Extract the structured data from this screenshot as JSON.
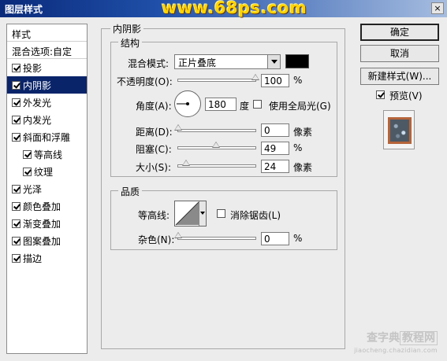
{
  "window": {
    "title": "图层样式",
    "brand": "www.68ps.com",
    "close_glyph": "×"
  },
  "styles_panel": {
    "header": "样式",
    "blend_options": "混合选项:自定",
    "items": [
      {
        "label": "投影",
        "checked": true
      },
      {
        "label": "内阴影",
        "checked": true,
        "selected": true
      },
      {
        "label": "外发光",
        "checked": true
      },
      {
        "label": "内发光",
        "checked": true
      },
      {
        "label": "斜面和浮雕",
        "checked": true
      },
      {
        "label": "等高线",
        "checked": true,
        "sub": true
      },
      {
        "label": "纹理",
        "checked": true,
        "sub": true
      },
      {
        "label": "光泽",
        "checked": true
      },
      {
        "label": "颜色叠加",
        "checked": true
      },
      {
        "label": "渐变叠加",
        "checked": true
      },
      {
        "label": "图案叠加",
        "checked": true
      },
      {
        "label": "描边",
        "checked": true
      }
    ]
  },
  "inner_shadow": {
    "group_title": "内阴影",
    "structure": {
      "title": "结构",
      "blend_mode_label": "混合模式:",
      "blend_mode_value": "正片叠底",
      "color": "#000000",
      "opacity_label": "不透明度(O):",
      "opacity_value": "100",
      "opacity_unit": "%",
      "opacity_percent": 100,
      "angle_label": "角度(A):",
      "angle_value": "180",
      "angle_unit": "度",
      "angle_degrees": 180,
      "global_light_label": "使用全局光(G)",
      "global_light_checked": false,
      "distance_label": "距离(D):",
      "distance_value": "0",
      "distance_unit": "像素",
      "distance_fraction": 0.0,
      "choke_label": "阻塞(C):",
      "choke_value": "49",
      "choke_unit": "%",
      "choke_fraction": 0.49,
      "size_label": "大小(S):",
      "size_value": "24",
      "size_unit": "像素",
      "size_fraction": 0.1
    },
    "quality": {
      "title": "品质",
      "contour_label": "等高线:",
      "antialias_label": "消除锯齿(L)",
      "antialias_checked": false,
      "noise_label": "杂色(N):",
      "noise_value": "0",
      "noise_unit": "%",
      "noise_fraction": 0.0
    }
  },
  "buttons": {
    "ok": "确定",
    "cancel": "取消",
    "new_style": "新建样式(W)...",
    "preview_label": "预览(V)",
    "preview_checked": true
  },
  "watermark": {
    "line1": "查字典",
    "line2": "教程网",
    "line3": "jiaocheng.chazidian.com"
  }
}
